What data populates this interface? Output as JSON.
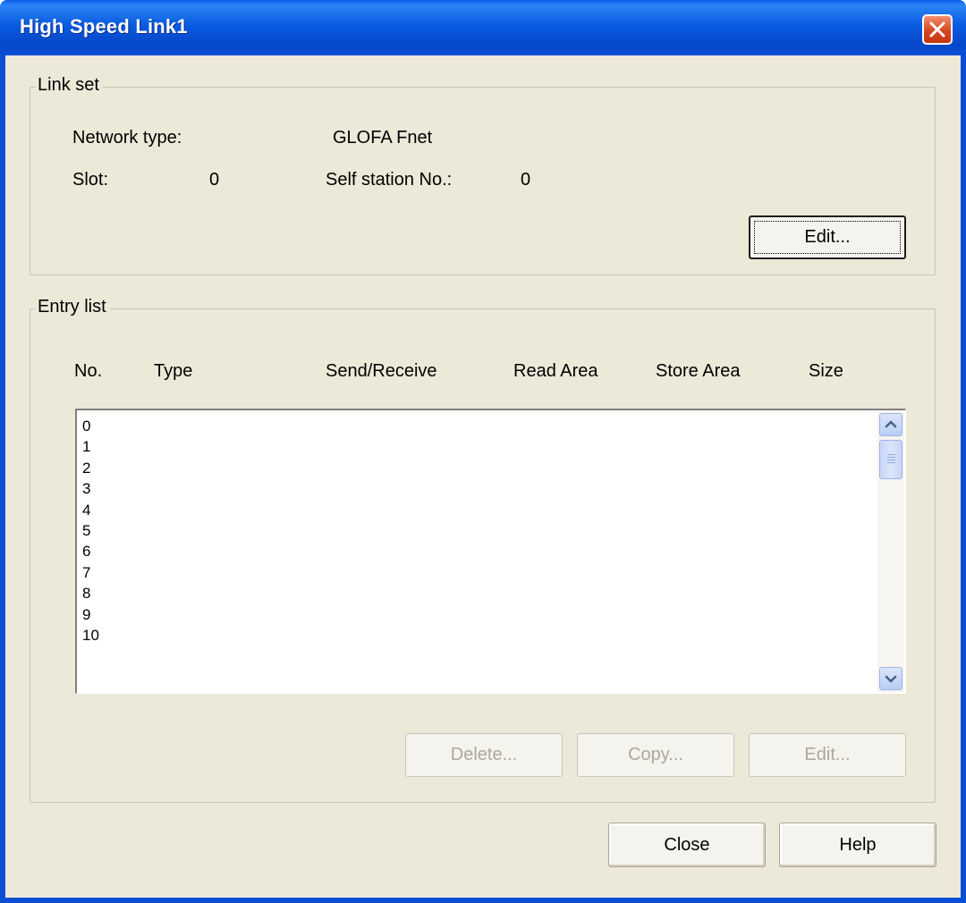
{
  "window": {
    "title": "High Speed Link1"
  },
  "link_set": {
    "legend": "Link set",
    "network_type_label": "Network type:",
    "network_type_value": "GLOFA Fnet",
    "slot_label": "Slot:",
    "slot_value": "0",
    "self_station_label": "Self station No.:",
    "self_station_value": "0",
    "edit_button": "Edit..."
  },
  "entry_list": {
    "legend": "Entry list",
    "columns": [
      "No.",
      "Type",
      "Send/Receive",
      "Read Area",
      "Store Area",
      "Size"
    ],
    "rows": [
      "0",
      "1",
      "2",
      "3",
      "4",
      "5",
      "6",
      "7",
      "8",
      "9",
      "10"
    ],
    "delete_button": "Delete...",
    "copy_button": "Copy...",
    "edit_button": "Edit..."
  },
  "footer": {
    "close_button": "Close",
    "help_button": "Help"
  },
  "colors": {
    "titlebar": "#0a5be0",
    "dialog_bg": "#ece9d8",
    "close_red": "#d8461f",
    "disabled_text": "#aca899"
  }
}
